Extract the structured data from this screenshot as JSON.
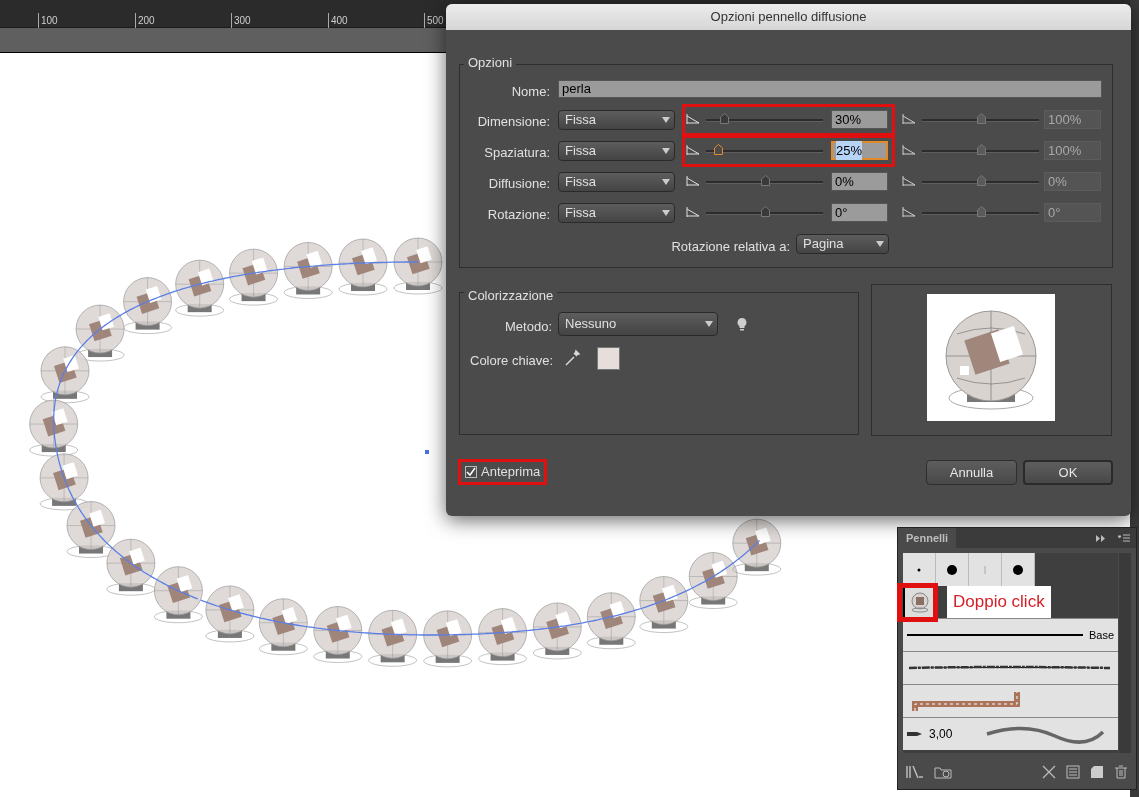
{
  "ruler": {
    "labels": [
      "100",
      "200",
      "300",
      "400",
      "500"
    ]
  },
  "dialog": {
    "title": "Opzioni pennello diffusione",
    "options": {
      "legend": "Opzioni",
      "name_label": "Nome:",
      "name_value": "perla",
      "rows": [
        {
          "label": "Dimensione:",
          "mode": "Fissa",
          "highlighted": true,
          "focused": false,
          "level": 0.15,
          "value": "30%",
          "max_value": "100%"
        },
        {
          "label": "Spaziatura:",
          "mode": "Fissa",
          "highlighted": true,
          "focused": true,
          "level": 0.1,
          "value": "25%",
          "max_value": "100%"
        },
        {
          "label": "Diffusione:",
          "mode": "Fissa",
          "highlighted": false,
          "focused": false,
          "level": 0.5,
          "value": "0%",
          "max_value": "0%"
        },
        {
          "label": "Rotazione:",
          "mode": "Fissa",
          "highlighted": false,
          "focused": false,
          "level": 0.5,
          "value": "0°",
          "max_value": "0°"
        }
      ],
      "rotation_relative": {
        "label": "Rotazione relativa a:",
        "value": "Pagina"
      }
    },
    "colorization": {
      "legend": "Colorizzazione",
      "method_label": "Metodo:",
      "method_value": "Nessuno",
      "key_color_label": "Colore chiave:"
    },
    "preview": {
      "label": "Anteprima",
      "checked": true,
      "highlighted": true
    },
    "buttons": [
      {
        "label": "Annulla",
        "default": false
      },
      {
        "label": "OK",
        "default": true
      }
    ]
  },
  "brushes_panel": {
    "title": "Pennelli",
    "dot_brushes": [
      {
        "kind": "small-dot"
      },
      {
        "kind": "large-dot"
      },
      {
        "kind": "hairline"
      },
      {
        "kind": "large-dot"
      }
    ],
    "scatter_brush": {
      "selected": true,
      "highlighted": true,
      "callout": "Doppio click"
    },
    "brushes": [
      {
        "kind": "line",
        "label": "Base"
      },
      {
        "kind": "charcoal"
      },
      {
        "kind": "pattern"
      },
      {
        "kind": "bristle",
        "label": "3,00"
      }
    ]
  }
}
